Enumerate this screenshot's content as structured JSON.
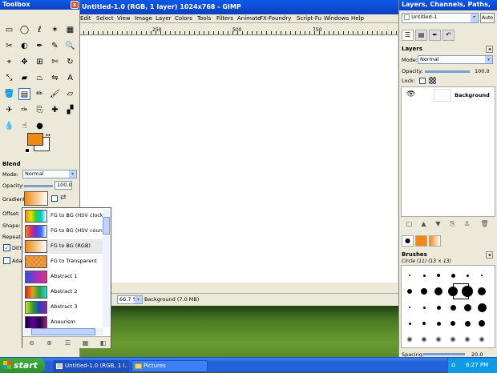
{
  "toolbox": {
    "title": "Toolbox",
    "close_glyph": "x",
    "tools": [
      {
        "icon": "rect-select-icon",
        "glyph": "▭"
      },
      {
        "icon": "ellipse-select-icon",
        "glyph": "◯"
      },
      {
        "icon": "free-select-icon",
        "glyph": "ℓ"
      },
      {
        "icon": "fuzzy-select-icon",
        "glyph": "✶"
      },
      {
        "icon": "color-select-icon",
        "glyph": "▦"
      },
      {
        "icon": "scissors-icon",
        "glyph": "✂"
      },
      {
        "icon": "foreground-select-icon",
        "glyph": "◐"
      },
      {
        "icon": "paths-icon",
        "glyph": "✒"
      },
      {
        "icon": "color-picker-icon",
        "glyph": "✎"
      },
      {
        "icon": "zoom-icon",
        "glyph": "🔍"
      },
      {
        "icon": "measure-icon",
        "glyph": "⌖"
      },
      {
        "icon": "move-icon",
        "glyph": "✥"
      },
      {
        "icon": "align-icon",
        "glyph": "⊞"
      },
      {
        "icon": "crop-icon",
        "glyph": "✄"
      },
      {
        "icon": "rotate-icon",
        "glyph": "↻"
      },
      {
        "icon": "scale-icon",
        "glyph": "⤡"
      },
      {
        "icon": "shear-icon",
        "glyph": "▰"
      },
      {
        "icon": "perspective-icon",
        "glyph": "⏢"
      },
      {
        "icon": "flip-icon",
        "glyph": "⇋"
      },
      {
        "icon": "text-icon",
        "glyph": "A"
      },
      {
        "icon": "bucket-fill-icon",
        "glyph": "🪣"
      },
      {
        "icon": "blend-icon",
        "glyph": "▤"
      },
      {
        "icon": "pencil-icon",
        "glyph": "✏"
      },
      {
        "icon": "paintbrush-icon",
        "glyph": "🖌"
      },
      {
        "icon": "eraser-icon",
        "glyph": "▱"
      },
      {
        "icon": "airbrush-icon",
        "glyph": "✈"
      },
      {
        "icon": "ink-icon",
        "glyph": "✑"
      },
      {
        "icon": "clone-icon",
        "glyph": "⎘"
      },
      {
        "icon": "heal-icon",
        "glyph": "✚"
      },
      {
        "icon": "perspective-clone-icon",
        "glyph": "▞"
      },
      {
        "icon": "blur-icon",
        "glyph": "💧"
      },
      {
        "icon": "smudge-icon",
        "glyph": "☝"
      },
      {
        "icon": "dodge-burn-icon",
        "glyph": "●"
      }
    ],
    "fg_color": "#f08a14",
    "bg_color": "#ffffff",
    "options": {
      "title": "Blend",
      "mode_label": "Mode:",
      "mode_value": "Normal",
      "opacity_label": "Opacity:",
      "opacity_value": "100.0",
      "gradient_label": "Gradient:",
      "offset_label": "Offset:",
      "shape_label": "Shape:",
      "repeat_label": "Repeat:",
      "dither_label": "Dithe",
      "adaptive_label": "Adap"
    }
  },
  "gradient_popup": {
    "items": [
      {
        "name": "FG to BG (HSV clockw",
        "gradient": "linear-gradient(90deg,#f08a14,#e8e000,#30d030,#00c8e0,#fff)"
      },
      {
        "name": "FG to BG (HSV counte",
        "gradient": "linear-gradient(90deg,#f08a14,#e03060,#7030e0,#3070ff,#fff)"
      },
      {
        "name": "FG to BG (RGB)",
        "gradient": "linear-gradient(90deg,#f08a14,#fff)"
      },
      {
        "name": "FG to Transparent",
        "gradient": "repeating-conic-gradient(#f08a14 0 25%,#d9a060 0 50%) 0 0/6px 6px"
      },
      {
        "name": "Abstract 1",
        "gradient": "linear-gradient(90deg,#3050e0,#a030c0,#e03080)"
      },
      {
        "name": "Abstract 2",
        "gradient": "linear-gradient(90deg,#e02020,#e0a020,#20a040,#20e0e0)"
      },
      {
        "name": "Abstract 3",
        "gradient": "linear-gradient(90deg,#e0e020,#30a030,#2040c0,#a020a0)"
      },
      {
        "name": "Aneurism",
        "gradient": "linear-gradient(90deg,#100030,#6000a0,#200040,#a02080)"
      }
    ]
  },
  "image_window": {
    "title": "Untitled-1.0 (RGB, 1 layer) 1024x768 - GIMP",
    "menu": [
      "Edit",
      "Select",
      "View",
      "Image",
      "Layer",
      "Colors",
      "Tools",
      "Filters",
      "Animate",
      "FX-Foundry",
      "Script-Fu",
      "Windows",
      "Help"
    ],
    "ruler_labels": [
      "250",
      "500",
      "750"
    ],
    "zoom": "66.7 %",
    "status": "Background (7.0 MB)"
  },
  "dock": {
    "title": "Layers, Channels, Paths, Undo -",
    "image_select": "Untitled-1",
    "auto_label": "Auto",
    "layers": {
      "title": "Layers",
      "mode_label": "Mode:",
      "mode_value": "Normal",
      "opacity_label": "Opacity:",
      "opacity_value": "100.0",
      "lock_label": "Lock:",
      "layer_name": "Background"
    },
    "brushes": {
      "title": "Brushes",
      "current": "Circle (11) (13 × 13)",
      "spacing_label": "Spacing:",
      "spacing_value": "20.0"
    }
  },
  "taskbar": {
    "start_label": "start",
    "tasks": [
      "Untitled-1.0 (RGB, 1 l...",
      "Pictures"
    ],
    "time": "6:27 PM"
  }
}
